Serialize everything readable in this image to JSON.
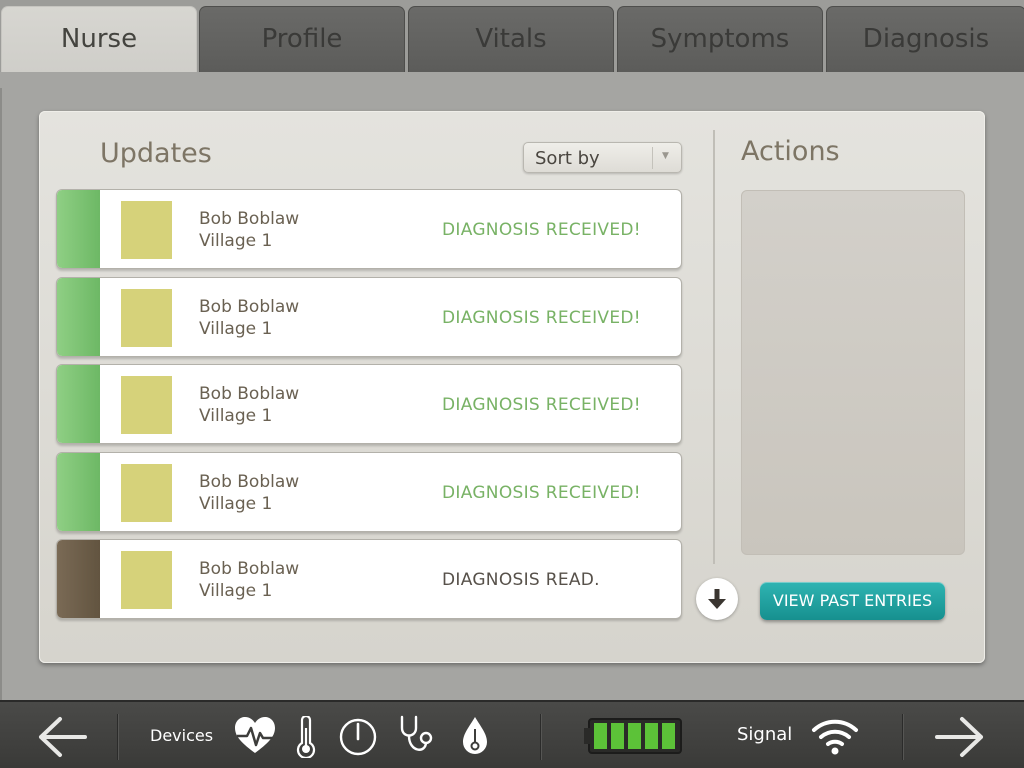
{
  "tabs": [
    {
      "label": "Nurse",
      "active": true
    },
    {
      "label": "Profile",
      "active": false
    },
    {
      "label": "Vitals",
      "active": false
    },
    {
      "label": "Symptoms",
      "active": false
    },
    {
      "label": "Diagnosis",
      "active": false
    }
  ],
  "updates": {
    "title": "Updates",
    "sort_label": "Sort by",
    "items": [
      {
        "name": "Bob Boblaw",
        "location": "Village 1",
        "status": "DIAGNOSIS RECEIVED!",
        "state": "received"
      },
      {
        "name": "Bob Boblaw",
        "location": "Village 1",
        "status": "DIAGNOSIS RECEIVED!",
        "state": "received"
      },
      {
        "name": "Bob Boblaw",
        "location": "Village 1",
        "status": "DIAGNOSIS RECEIVED!",
        "state": "received"
      },
      {
        "name": "Bob Boblaw",
        "location": "Village 1",
        "status": "DIAGNOSIS RECEIVED!",
        "state": "received"
      },
      {
        "name": "Bob Boblaw",
        "location": "Village 1",
        "status": "DIAGNOSIS READ.",
        "state": "read"
      }
    ]
  },
  "actions": {
    "title": "Actions",
    "view_past_label": "VIEW PAST ENTRIES"
  },
  "bottom_bar": {
    "devices_label": "Devices",
    "signal_label": "Signal",
    "battery_level": 1.0,
    "icons": [
      "back-arrow-icon",
      "heart-rate-icon",
      "thermometer-icon",
      "gauge-icon",
      "stethoscope-icon",
      "drop-icon",
      "battery-icon",
      "wifi-icon",
      "forward-arrow-icon"
    ]
  },
  "colors": {
    "received_green": "#78b265",
    "read_brown": "#625440",
    "accent_teal": "#1ea2a0",
    "battery_green": "#5cc238"
  }
}
